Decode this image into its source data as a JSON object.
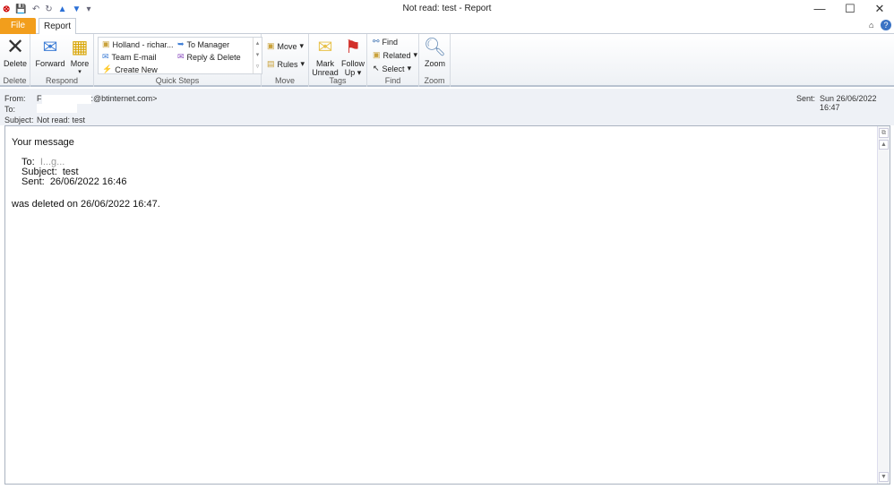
{
  "window": {
    "title": "Not read: test  -  Report",
    "minimize": "—",
    "maximize": "☐",
    "close": "✕"
  },
  "qat": {
    "save": "💾",
    "undo": "↶",
    "redo": "↻",
    "prev": "▲",
    "next": "▼",
    "customize": "▾"
  },
  "tabs": [
    {
      "label": "File"
    },
    {
      "label": "Report"
    }
  ],
  "ribbon": {
    "groups": {
      "delete": "Delete",
      "respond": "Respond",
      "quick_steps": "Quick Steps",
      "move": "Move",
      "tags": "Tags",
      "find": "Find",
      "zoom": "Zoom"
    },
    "delete": "Delete",
    "forward": "Forward",
    "more": "More",
    "quick_steps": [
      "Holland - richar...",
      "To Manager",
      "Team E-mail",
      "Reply & Delete",
      "Create New"
    ],
    "move": "Move",
    "rules": "Rules",
    "mark_unread": [
      "Mark",
      "Unread"
    ],
    "follow_up": [
      "Follow",
      "Up"
    ],
    "find": "Find",
    "related": "Related",
    "select": "Select",
    "zoom": "Zoom"
  },
  "header": {
    "from_label": "From:",
    "from_value_start": "F",
    "from_value_end": ":@btinternet.com>",
    "to_label": "To:",
    "subject_label": "Subject:",
    "subject_value": "Not read: test",
    "sent_label": "Sent:",
    "sent_value": "Sun 26/06/2022 16:47"
  },
  "message": {
    "intro": "Your message",
    "to_label": "To:",
    "to_value": "I...g...",
    "subject_label": "Subject:",
    "subject_value": "test",
    "sent_label": "Sent:",
    "sent_value": "26/06/2022 16:46",
    "deleted": "was deleted on 26/06/2022 16:47."
  },
  "colors": {
    "file_tab": "#f29e1c",
    "header_bg": "#eef1f6"
  }
}
